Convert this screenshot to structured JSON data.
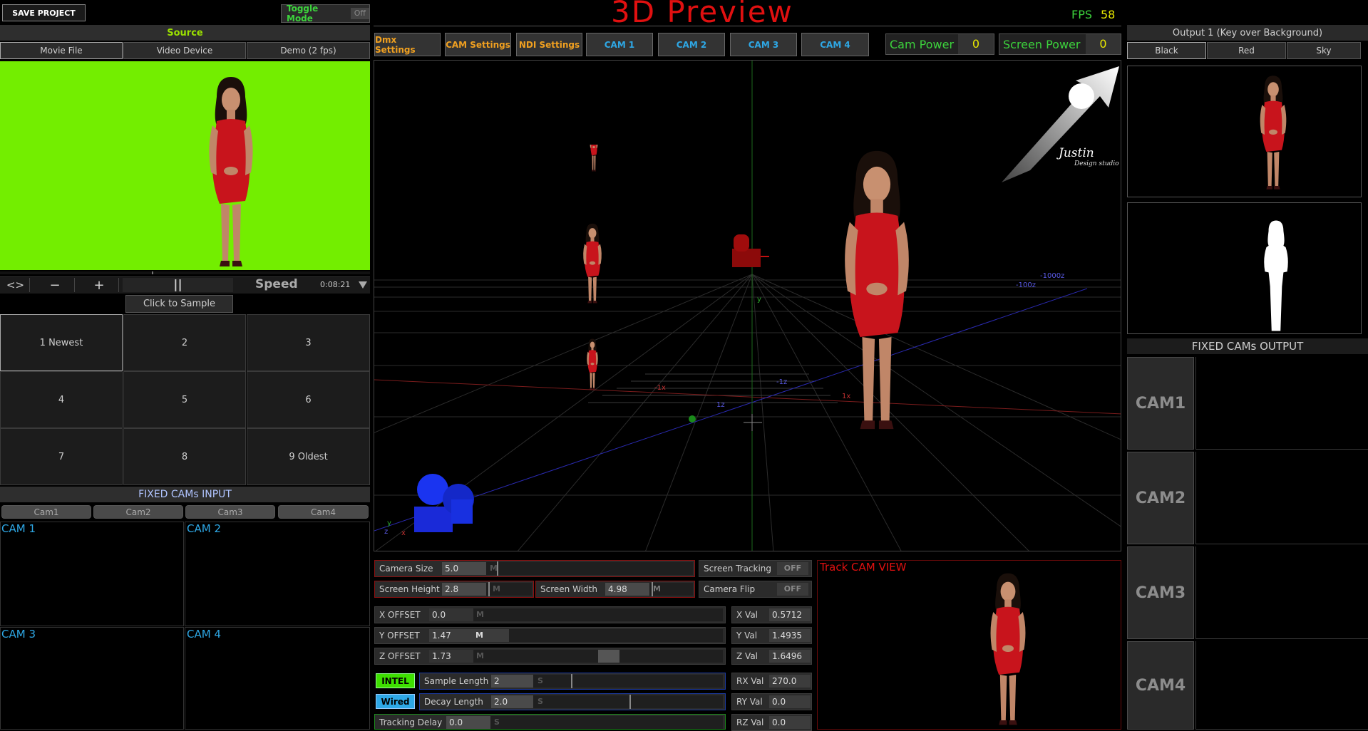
{
  "app": {
    "save_project": "SAVE PROJECT",
    "toggle_mode": "Toggle Mode",
    "toggle_mode_state": "Off",
    "title": "3D Preview",
    "fps_label": "FPS",
    "fps_value": "58"
  },
  "source": {
    "header": "Source",
    "tabs": [
      "Movie File",
      "Video Device",
      "Demo (2 fps)"
    ],
    "playback": {
      "swap": "<>",
      "minus": "−",
      "plus": "+",
      "pause": "||",
      "speed": "Speed",
      "time": "0:08:21",
      "progress": 0.41
    },
    "click_to_sample": "Click to Sample",
    "samples": [
      "1 Newest",
      "2",
      "3",
      "4",
      "5",
      "6",
      "7",
      "8",
      "9 Oldest"
    ]
  },
  "fixed_input": {
    "header": "FIXED CAMs INPUT",
    "tabs": [
      "Cam1",
      "Cam2",
      "Cam3",
      "Cam4"
    ],
    "cams": [
      "CAM 1",
      "CAM 2",
      "CAM 3",
      "CAM 4"
    ]
  },
  "toolbar": {
    "dmx": "Dmx Settings",
    "cam_settings": "CAM Settings",
    "ndi": "NDI Settings",
    "cams": [
      "CAM 1",
      "CAM 2",
      "CAM 3",
      "CAM 4"
    ],
    "cam_power": "Cam Power",
    "cam_power_value": "0",
    "screen_power": "Screen Power",
    "screen_power_value": "0"
  },
  "viewport": {
    "axis_labels": {
      "minus_1000z": "-1000z",
      "minus_100z": "-100z",
      "y": "y",
      "minus_1x": "-1x",
      "one_x": "1x",
      "minus_1z": "-1z",
      "one_z": "1z",
      "gizmo_y": "y",
      "gizmo_z": "z",
      "gizmo_x": "x"
    },
    "logo_script": "Justin",
    "logo_sub": "Design studio"
  },
  "controls": {
    "camera_size": {
      "label": "Camera Size",
      "value": "5.0",
      "m": "M",
      "level": 0.05
    },
    "screen_height": {
      "label": "Screen Height",
      "value": "2.8",
      "m": "M",
      "level": 0.05
    },
    "screen_width": {
      "label": "Screen Width",
      "value": "4.98",
      "m": "M",
      "level": 0.05
    },
    "screen_tracking": {
      "label": "Screen Tracking",
      "state": "OFF"
    },
    "camera_flip": {
      "label": "Camera Flip",
      "state": "OFF"
    },
    "x_offset": {
      "label": "X OFFSET",
      "value": "0.0",
      "m": "M"
    },
    "y_offset": {
      "label": "Y OFFSET",
      "value": "1.47",
      "m": "M"
    },
    "z_offset": {
      "label": "Z OFFSET",
      "value": "1.73",
      "m": "M"
    },
    "intel": "INTEL",
    "wired": "Wired",
    "sample_length": {
      "label": "Sample Length",
      "value": "2",
      "s": "S"
    },
    "decay_length": {
      "label": "Decay Length",
      "value": "2.0",
      "s": "S"
    },
    "tracking_delay": {
      "label": "Tracking Delay",
      "value": "0.0",
      "s": "S"
    },
    "x_val": {
      "label": "X Val",
      "value": "0.5712"
    },
    "y_val": {
      "label": "Y Val",
      "value": "1.4935"
    },
    "z_val": {
      "label": "Z Val",
      "value": "1.6496"
    },
    "rx_val": {
      "label": "RX Val",
      "value": "270.0"
    },
    "ry_val": {
      "label": "RY Val",
      "value": "0.0"
    },
    "rz_val": {
      "label": "RZ Val",
      "value": "0.0"
    }
  },
  "track_view": {
    "title": "Track CAM VIEW"
  },
  "output": {
    "header": "Output 1 (Key over Background)",
    "tabs": [
      "Black",
      "Red",
      "Sky"
    ]
  },
  "fixed_output": {
    "header": "FIXED CAMs OUTPUT",
    "cams": [
      "CAM1",
      "CAM2",
      "CAM3",
      "CAM4"
    ]
  },
  "colors": {
    "title_red": "#e01010",
    "chroma_green": "#73ee00",
    "orange": "#f0a020",
    "cyan": "#2ea8e6",
    "lime": "#9be000",
    "fps_green": "#3cd23c"
  }
}
